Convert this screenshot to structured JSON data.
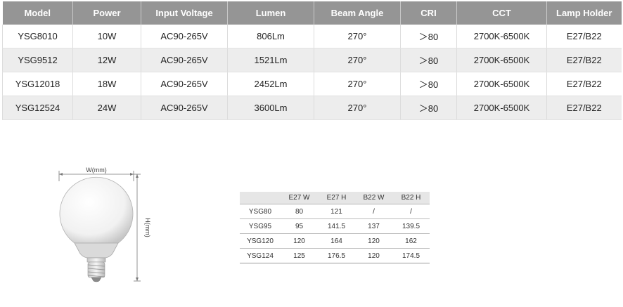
{
  "spec_table": {
    "headers": [
      "Model",
      "Power",
      "Input Voltage",
      "Lumen",
      "Beam Angle",
      "CRI",
      "CCT",
      "Lamp Holder"
    ],
    "rows": [
      [
        "YSG8010",
        "10W",
        "AC90-265V",
        "806Lm",
        "270°",
        "＞80",
        "2700K-6500K",
        "E27/B22"
      ],
      [
        "YSG9512",
        "12W",
        "AC90-265V",
        "1521Lm",
        "270°",
        "＞80",
        "2700K-6500K",
        "E27/B22"
      ],
      [
        "YSG12018",
        "18W",
        "AC90-265V",
        "2452Lm",
        "270°",
        "＞80",
        "2700K-6500K",
        "E27/B22"
      ],
      [
        "YSG12524",
        "24W",
        "AC90-265V",
        "3600Lm",
        "270°",
        "＞80",
        "2700K-6500K",
        "E27/B22"
      ]
    ]
  },
  "diagram": {
    "width_label": "W(mm)",
    "height_label": "H(mm)"
  },
  "dimension_table": {
    "headers": [
      "",
      "E27 W",
      "E27 H",
      "B22 W",
      "B22 H"
    ],
    "rows": [
      [
        "YSG80",
        "80",
        "121",
        "/",
        "/"
      ],
      [
        "YSG95",
        "95",
        "141.5",
        "137",
        "139.5"
      ],
      [
        "YSG120",
        "120",
        "164",
        "120",
        "162"
      ],
      [
        "YSG124",
        "125",
        "176.5",
        "120",
        "174.5"
      ]
    ]
  },
  "colors": {
    "header_bg": "#959595",
    "header_text": "#ffffff",
    "stripe_bg": "#ededed"
  }
}
